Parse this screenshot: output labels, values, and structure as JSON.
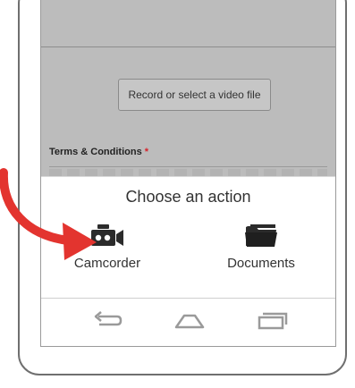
{
  "form": {
    "record_button_label": "Record or select a video file",
    "terms_label": "Terms & Conditions",
    "required_marker": "*"
  },
  "chooser": {
    "title": "Choose an action",
    "options": [
      {
        "label": "Camcorder",
        "icon": "camcorder-icon"
      },
      {
        "label": "Documents",
        "icon": "folder-icon"
      }
    ]
  },
  "navbar": {
    "buttons": [
      {
        "icon": "back-icon"
      },
      {
        "icon": "home-icon"
      },
      {
        "icon": "recent-apps-icon"
      }
    ]
  },
  "annotation": {
    "arrow_color": "#e3342f"
  },
  "colors": {
    "dim_overlay": "#bcbcbc",
    "required_marker": "#d6222a",
    "text": "#333333",
    "frame": "#6f6f6f"
  }
}
